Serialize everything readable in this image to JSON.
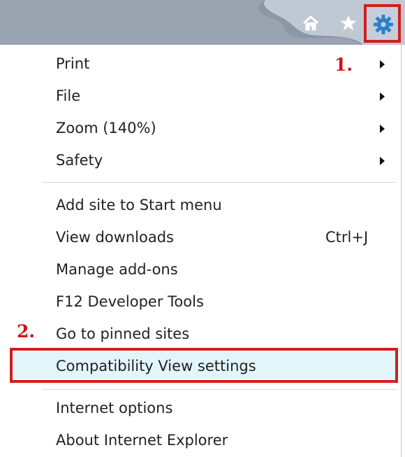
{
  "toolbar": {
    "icons": [
      "home-icon",
      "star-icon",
      "gear-icon"
    ]
  },
  "menu": {
    "groups": [
      [
        {
          "label": "Print",
          "submenu": true
        },
        {
          "label": "File",
          "submenu": true
        },
        {
          "label": "Zoom (140%)",
          "submenu": true
        },
        {
          "label": "Safety",
          "submenu": true
        }
      ],
      [
        {
          "label": "Add site to Start menu"
        },
        {
          "label": "View downloads",
          "shortcut": "Ctrl+J"
        },
        {
          "label": "Manage add-ons"
        },
        {
          "label": "F12 Developer Tools"
        },
        {
          "label": "Go to pinned sites"
        },
        {
          "label": "Compatibility View settings",
          "highlighted": true
        }
      ],
      [
        {
          "label": "Internet options"
        },
        {
          "label": "About Internet Explorer"
        }
      ]
    ]
  },
  "annotations": {
    "step1": "1.",
    "step2": "2."
  },
  "colors": {
    "highlight_red": "#d51c1c",
    "toolbar_bg": "#8c96a6",
    "selected_bg": "#e2f5fb",
    "gear_blue": "#2f80c7"
  }
}
